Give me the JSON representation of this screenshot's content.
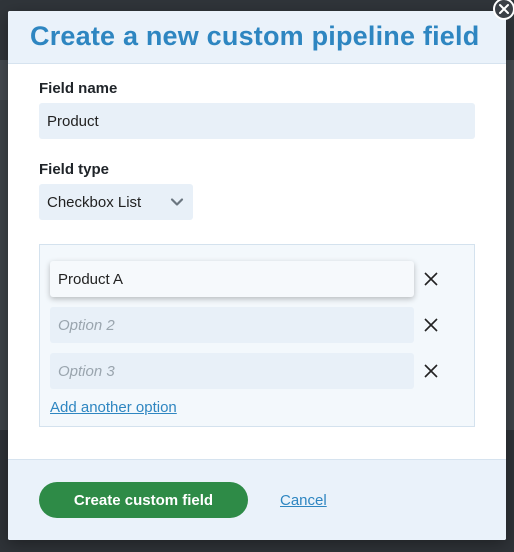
{
  "modal": {
    "title": "Create a new custom pipeline field",
    "close_icon": "close-icon"
  },
  "field_name": {
    "label": "Field name",
    "value": "Product"
  },
  "field_type": {
    "label": "Field type",
    "selected": "Checkbox List",
    "icon": "chevron-down-icon"
  },
  "options": [
    {
      "value": "Product A",
      "placeholder": ""
    },
    {
      "value": "",
      "placeholder": "Option 2"
    },
    {
      "value": "",
      "placeholder": "Option 3"
    }
  ],
  "add_option_label": "Add another option",
  "footer": {
    "create_label": "Create custom field",
    "cancel_label": "Cancel"
  },
  "colors": {
    "title": "#2e86c1",
    "link": "#2e86c1",
    "primary_button": "#2e8b47",
    "input_bg": "#e8f0f8",
    "header_bg": "#eaf2fa"
  }
}
